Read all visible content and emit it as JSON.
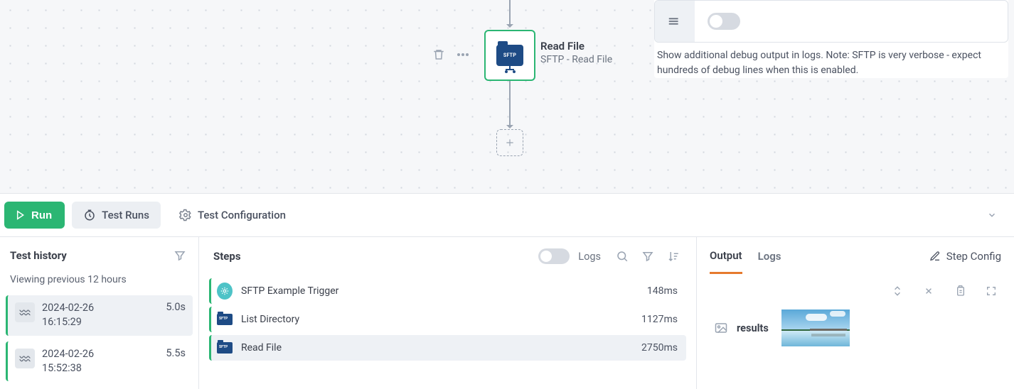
{
  "canvas": {
    "node": {
      "title": "Read File",
      "subtitle": "SFTP - Read File",
      "badge_text": "SFTP"
    }
  },
  "debug_panel": {
    "description": "Show additional debug output in logs. Note: SFTP is very verbose - expect hundreds of debug lines when this is enabled.",
    "toggle_on": false
  },
  "toolbar": {
    "run_label": "Run",
    "test_runs_label": "Test Runs",
    "test_config_label": "Test Configuration"
  },
  "history": {
    "title": "Test history",
    "subtitle": "Viewing previous 12 hours",
    "items": [
      {
        "date": "2024-02-26",
        "time": "16:15:29",
        "duration": "5.0s",
        "selected": true
      },
      {
        "date": "2024-02-26",
        "time": "15:52:38",
        "duration": "5.5s",
        "selected": false
      }
    ]
  },
  "steps": {
    "title": "Steps",
    "logs_toggle_label": "Logs",
    "items": [
      {
        "name": "SFTP Example Trigger",
        "duration": "148ms",
        "icon": "trigger",
        "selected": false
      },
      {
        "name": "List Directory",
        "duration": "1127ms",
        "icon": "sftp",
        "selected": false
      },
      {
        "name": "Read File",
        "duration": "2750ms",
        "icon": "sftp",
        "selected": true
      }
    ]
  },
  "output": {
    "tabs": {
      "output": "Output",
      "logs": "Logs"
    },
    "step_config_label": "Step Config",
    "results_label": "results"
  }
}
